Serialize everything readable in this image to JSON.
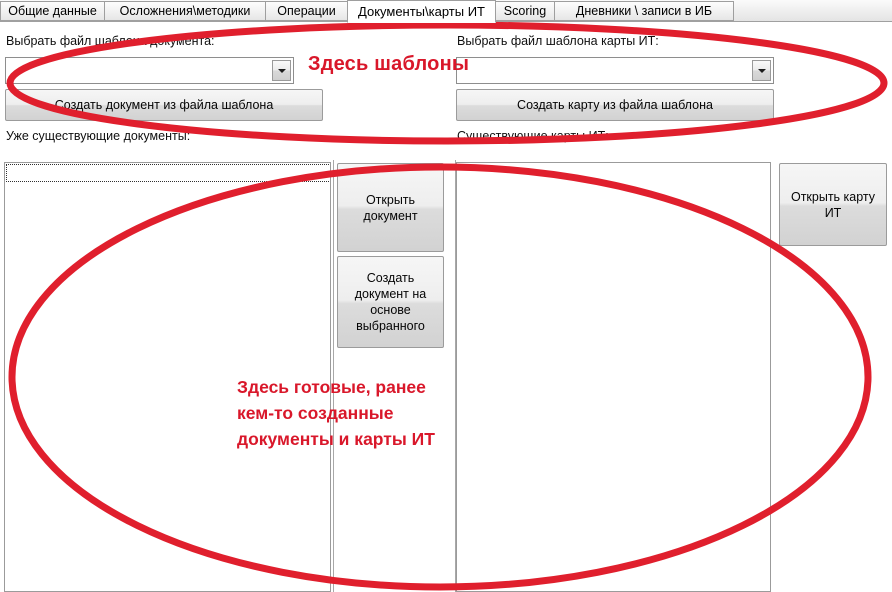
{
  "window": {
    "title": "Документы\\карты ИТ"
  },
  "tabs": [
    {
      "label": "Общие данные",
      "active": false
    },
    {
      "label": "Осложнения\\методики",
      "active": false
    },
    {
      "label": "Операции",
      "active": false
    },
    {
      "label": "Документы\\карты ИТ",
      "active": true
    },
    {
      "label": "Scoring",
      "active": false
    },
    {
      "label": "Дневники \\ записи в ИБ",
      "active": false
    }
  ],
  "left_panel": {
    "template_label": "Выбрать файл шаблона документа:",
    "template_combo_value": "",
    "template_combo_placeholder": "",
    "create_button": "Создать документ из файла шаблона",
    "existing_label": "Уже существующие документы:",
    "list_items": []
  },
  "right_panel": {
    "template_label": "Выбрать файл шаблона карты ИТ:",
    "template_combo_value": "",
    "template_combo_placeholder": "",
    "create_button": "Создать карту из файла шаблона",
    "existing_label": "Существующие карты ИТ:",
    "list_items": []
  },
  "middle_buttons": {
    "open_document": "Открыть документ",
    "create_from_selected": "Создать документ на основе выбранного"
  },
  "far_right_buttons": {
    "open_card": "Открыть карту ИТ"
  },
  "annotations": {
    "accent_color": "#d9172a",
    "top_text": "Здесь шаблоны",
    "middle_line1": "Здесь готовые, ранее",
    "middle_line2": "кем-то созданные",
    "middle_line3": "документы и карты ИТ"
  }
}
